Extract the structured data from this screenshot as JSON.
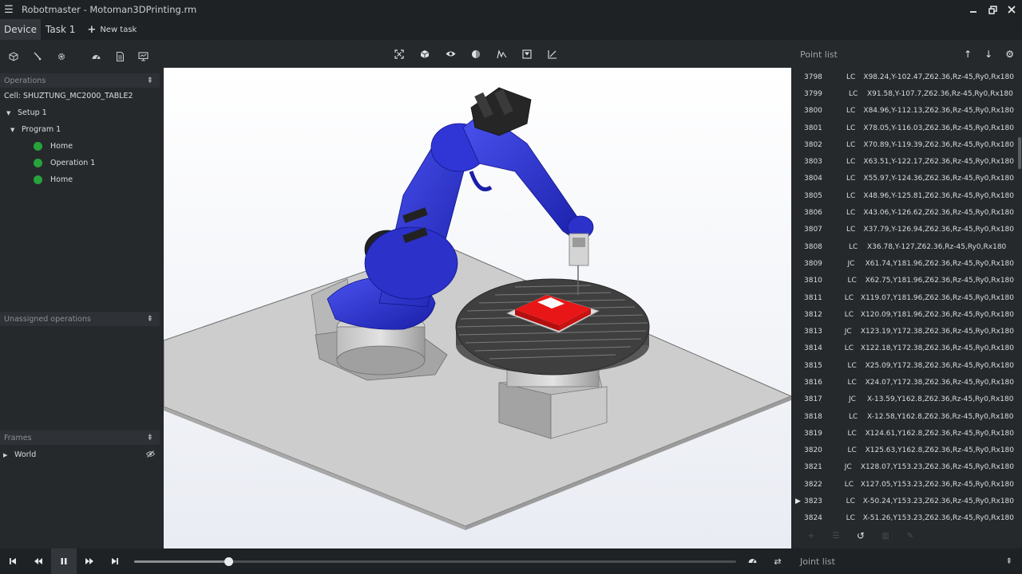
{
  "window": {
    "title": "Robotmaster - Motoman3DPrinting.rm"
  },
  "tabs": [
    {
      "label": "Device"
    },
    {
      "label": "Task 1"
    }
  ],
  "new_task_label": "New task",
  "left": {
    "operations_header": "Operations",
    "cell_label": "Cell: SHUZTUNG_MC2000_TABLE2",
    "setup_label": "Setup 1",
    "program_label": "Program 1",
    "ops": [
      {
        "label": "Home"
      },
      {
        "label": "Operation 1"
      },
      {
        "label": "Home"
      }
    ],
    "unassigned_header": "Unassigned operations",
    "frames_header": "Frames",
    "world_label": "World"
  },
  "point_list": {
    "title": "Point list",
    "rows": [
      {
        "num": "3798",
        "type": "LC",
        "coord": "X98.24,Y-102.47,Z62.36,Rz-45,Ry0,Rx180"
      },
      {
        "num": "3799",
        "type": "LC",
        "coord": "X91.58,Y-107.7,Z62.36,Rz-45,Ry0,Rx180"
      },
      {
        "num": "3800",
        "type": "LC",
        "coord": "X84.96,Y-112.13,Z62.36,Rz-45,Ry0,Rx180"
      },
      {
        "num": "3801",
        "type": "LC",
        "coord": "X78.05,Y-116.03,Z62.36,Rz-45,Ry0,Rx180"
      },
      {
        "num": "3802",
        "type": "LC",
        "coord": "X70.89,Y-119.39,Z62.36,Rz-45,Ry0,Rx180"
      },
      {
        "num": "3803",
        "type": "LC",
        "coord": "X63.51,Y-122.17,Z62.36,Rz-45,Ry0,Rx180"
      },
      {
        "num": "3804",
        "type": "LC",
        "coord": "X55.97,Y-124.36,Z62.36,Rz-45,Ry0,Rx180"
      },
      {
        "num": "3805",
        "type": "LC",
        "coord": "X48.96,Y-125.81,Z62.36,Rz-45,Ry0,Rx180"
      },
      {
        "num": "3806",
        "type": "LC",
        "coord": "X43.06,Y-126.62,Z62.36,Rz-45,Ry0,Rx180"
      },
      {
        "num": "3807",
        "type": "LC",
        "coord": "X37.79,Y-126.94,Z62.36,Rz-45,Ry0,Rx180"
      },
      {
        "num": "3808",
        "type": "LC",
        "coord": "X36.78,Y-127,Z62.36,Rz-45,Ry0,Rx180"
      },
      {
        "num": "3809",
        "type": "JC",
        "coord": "X61.74,Y181.96,Z62.36,Rz-45,Ry0,Rx180"
      },
      {
        "num": "3810",
        "type": "LC",
        "coord": "X62.75,Y181.96,Z62.36,Rz-45,Ry0,Rx180"
      },
      {
        "num": "3811",
        "type": "LC",
        "coord": "X119.07,Y181.96,Z62.36,Rz-45,Ry0,Rx180"
      },
      {
        "num": "3812",
        "type": "LC",
        "coord": "X120.09,Y181.96,Z62.36,Rz-45,Ry0,Rx180"
      },
      {
        "num": "3813",
        "type": "JC",
        "coord": "X123.19,Y172.38,Z62.36,Rz-45,Ry0,Rx180"
      },
      {
        "num": "3814",
        "type": "LC",
        "coord": "X122.18,Y172.38,Z62.36,Rz-45,Ry0,Rx180"
      },
      {
        "num": "3815",
        "type": "LC",
        "coord": "X25.09,Y172.38,Z62.36,Rz-45,Ry0,Rx180"
      },
      {
        "num": "3816",
        "type": "LC",
        "coord": "X24.07,Y172.38,Z62.36,Rz-45,Ry0,Rx180"
      },
      {
        "num": "3817",
        "type": "JC",
        "coord": "X-13.59,Y162.8,Z62.36,Rz-45,Ry0,Rx180"
      },
      {
        "num": "3818",
        "type": "LC",
        "coord": "X-12.58,Y162.8,Z62.36,Rz-45,Ry0,Rx180"
      },
      {
        "num": "3819",
        "type": "LC",
        "coord": "X124.61,Y162.8,Z62.36,Rz-45,Ry0,Rx180"
      },
      {
        "num": "3820",
        "type": "LC",
        "coord": "X125.63,Y162.8,Z62.36,Rz-45,Ry0,Rx180"
      },
      {
        "num": "3821",
        "type": "JC",
        "coord": "X128.07,Y153.23,Z62.36,Rz-45,Ry0,Rx180"
      },
      {
        "num": "3822",
        "type": "LC",
        "coord": "X127.05,Y153.23,Z62.36,Rz-45,Ry0,Rx180"
      },
      {
        "num": "3823",
        "type": "LC",
        "coord": "X-50.24,Y153.23,Z62.36,Rz-45,Ry0,Rx180"
      },
      {
        "num": "3824",
        "type": "LC",
        "coord": "X-51.26,Y153.23,Z62.36,Rz-45,Ry0,Rx180"
      }
    ],
    "current_row": "3823"
  },
  "joint_list": {
    "title": "Joint list"
  },
  "playback": {
    "progress": 0.157
  },
  "colors": {
    "robot": "#2a2fd0",
    "part": "#e81616",
    "status_ok": "#27a33a"
  }
}
